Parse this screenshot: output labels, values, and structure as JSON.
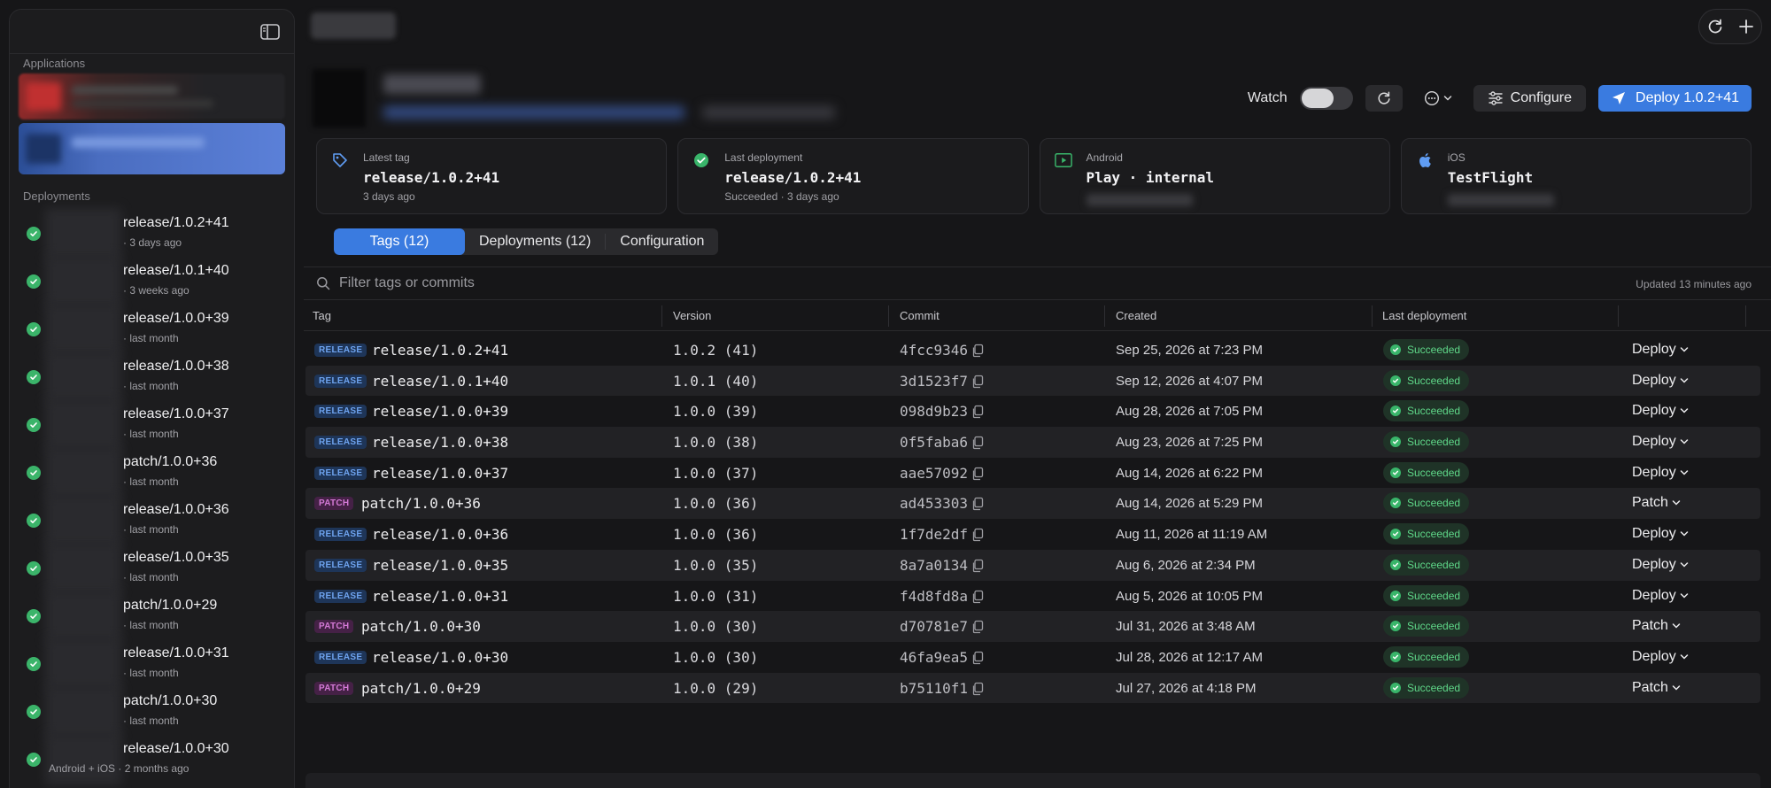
{
  "sidebar": {
    "applications_title": "Applications",
    "deployments_title": "Deployments",
    "deployments": [
      {
        "name": "release/1.0.2+41",
        "time": "· 3 days ago"
      },
      {
        "name": "release/1.0.1+40",
        "time": "· 3 weeks ago"
      },
      {
        "name": "release/1.0.0+39",
        "time": "· last month"
      },
      {
        "name": "release/1.0.0+38",
        "time": "· last month"
      },
      {
        "name": "release/1.0.0+37",
        "time": "· last month"
      },
      {
        "name": "patch/1.0.0+36",
        "time": "· last month"
      },
      {
        "name": "release/1.0.0+36",
        "time": "· last month"
      },
      {
        "name": "release/1.0.0+35",
        "time": "· last month"
      },
      {
        "name": "patch/1.0.0+29",
        "time": "· last month"
      },
      {
        "name": "release/1.0.0+31",
        "time": "· last month"
      },
      {
        "name": "patch/1.0.0+30",
        "time": "· last month"
      },
      {
        "name": "release/1.0.0+30",
        "time": "Android + iOS · 2 months ago"
      }
    ]
  },
  "header": {
    "watch_label": "Watch",
    "configure_label": "Configure",
    "deploy_label": "Deploy 1.0.2+41"
  },
  "cards": {
    "latest_tag": {
      "label": "Latest tag",
      "value": "release/1.0.2+41",
      "sub": "3 days ago"
    },
    "last_deployment": {
      "label": "Last deployment",
      "value": "release/1.0.2+41",
      "sub": "Succeeded · 3 days ago"
    },
    "android": {
      "label": "Android",
      "value": "Play · internal"
    },
    "ios": {
      "label": "iOS",
      "value": "TestFlight"
    }
  },
  "tabs": {
    "tags": "Tags (12)",
    "deployments": "Deployments (12)",
    "configuration": "Configuration"
  },
  "filter": {
    "placeholder": "Filter tags or commits",
    "updated": "Updated 13 minutes ago"
  },
  "table": {
    "columns": {
      "tag": "Tag",
      "version": "Version",
      "commit": "Commit",
      "created": "Created",
      "last_deployment": "Last deployment"
    },
    "rows": [
      {
        "badge": "RELEASE",
        "tag": "release/1.0.2+41",
        "version": "1.0.2 (41)",
        "commit": "4fcc9346",
        "created": "Sep 25, 2026 at 7:23 PM",
        "status": "Succeeded",
        "action": "Deploy"
      },
      {
        "badge": "RELEASE",
        "tag": "release/1.0.1+40",
        "version": "1.0.1 (40)",
        "commit": "3d1523f7",
        "created": "Sep 12, 2026 at 4:07 PM",
        "status": "Succeeded",
        "action": "Deploy"
      },
      {
        "badge": "RELEASE",
        "tag": "release/1.0.0+39",
        "version": "1.0.0 (39)",
        "commit": "098d9b23",
        "created": "Aug 28, 2026 at 7:05 PM",
        "status": "Succeeded",
        "action": "Deploy"
      },
      {
        "badge": "RELEASE",
        "tag": "release/1.0.0+38",
        "version": "1.0.0 (38)",
        "commit": "0f5faba6",
        "created": "Aug 23, 2026 at 7:25 PM",
        "status": "Succeeded",
        "action": "Deploy"
      },
      {
        "badge": "RELEASE",
        "tag": "release/1.0.0+37",
        "version": "1.0.0 (37)",
        "commit": "aae57092",
        "created": "Aug 14, 2026 at 6:22 PM",
        "status": "Succeeded",
        "action": "Deploy"
      },
      {
        "badge": "PATCH",
        "tag": "patch/1.0.0+36",
        "version": "1.0.0 (36)",
        "commit": "ad453303",
        "created": "Aug 14, 2026 at 5:29 PM",
        "status": "Succeeded",
        "action": "Patch"
      },
      {
        "badge": "RELEASE",
        "tag": "release/1.0.0+36",
        "version": "1.0.0 (36)",
        "commit": "1f7de2df",
        "created": "Aug 11, 2026 at 11:19 AM",
        "status": "Succeeded",
        "action": "Deploy"
      },
      {
        "badge": "RELEASE",
        "tag": "release/1.0.0+35",
        "version": "1.0.0 (35)",
        "commit": "8a7a0134",
        "created": "Aug 6, 2026 at 2:34 PM",
        "status": "Succeeded",
        "action": "Deploy"
      },
      {
        "badge": "RELEASE",
        "tag": "release/1.0.0+31",
        "version": "1.0.0 (31)",
        "commit": "f4d8fd8a",
        "created": "Aug 5, 2026 at 10:05 PM",
        "status": "Succeeded",
        "action": "Deploy"
      },
      {
        "badge": "PATCH",
        "tag": "patch/1.0.0+30",
        "version": "1.0.0 (30)",
        "commit": "d70781e7",
        "created": "Jul 31, 2026 at 3:48 AM",
        "status": "Succeeded",
        "action": "Patch"
      },
      {
        "badge": "RELEASE",
        "tag": "release/1.0.0+30",
        "version": "1.0.0 (30)",
        "commit": "46fa9ea5",
        "created": "Jul 28, 2026 at 12:17 AM",
        "status": "Succeeded",
        "action": "Deploy"
      },
      {
        "badge": "PATCH",
        "tag": "patch/1.0.0+29",
        "version": "1.0.0 (29)",
        "commit": "b75110f1",
        "created": "Jul 27, 2026 at 4:18 PM",
        "status": "Succeeded",
        "action": "Patch"
      }
    ]
  },
  "colors": {
    "accent": "#3a7be0",
    "success": "#39b56a",
    "release_badge": "#6ea3ef",
    "patch_badge": "#d47ad6"
  },
  "icons": {
    "sidebar_toggle": "sidebar-toggle-icon",
    "refresh": "refresh-icon",
    "plus": "plus-icon",
    "more": "more-icon",
    "configure": "sliders-icon",
    "deploy": "send-icon",
    "tag": "tag-icon",
    "check": "check-circle-icon",
    "android": "play-icon",
    "ios": "apple-icon",
    "search": "search-icon",
    "copy": "copy-icon",
    "chevron": "chevron-down-icon"
  }
}
